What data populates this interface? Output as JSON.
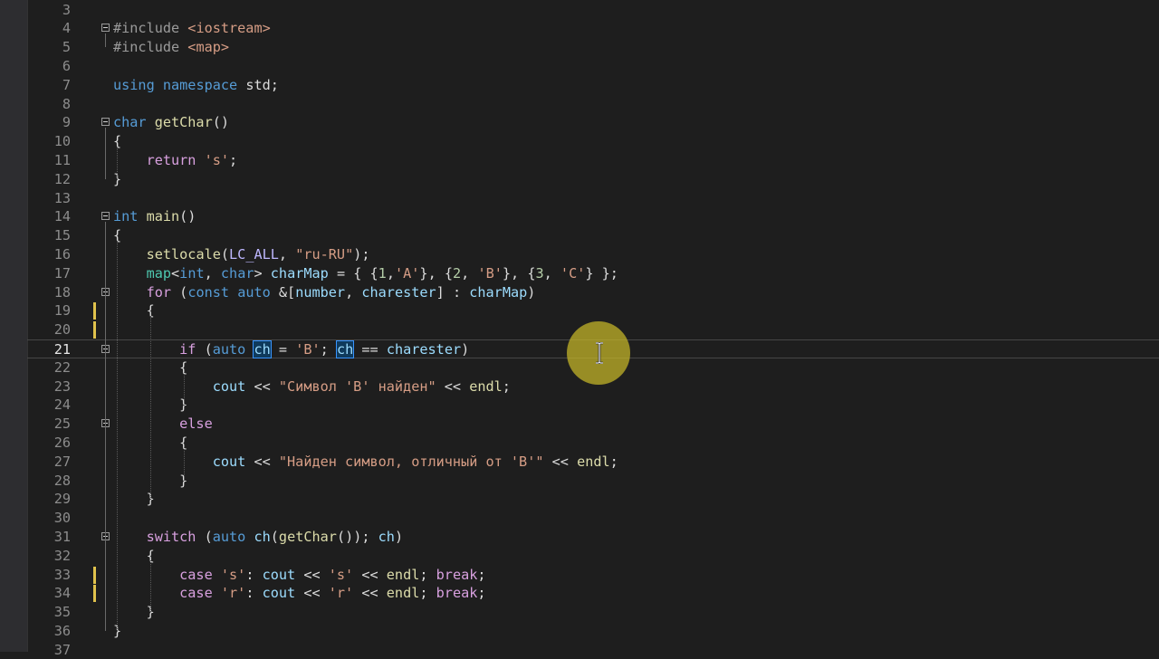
{
  "editor": {
    "current_line": "21",
    "lines": [
      {
        "n": "3",
        "tokens": []
      },
      {
        "n": "4",
        "tokens": [
          {
            "t": "#include ",
            "c": "pre"
          },
          {
            "t": "<iostream>",
            "c": "inc"
          }
        ]
      },
      {
        "n": "5",
        "tokens": [
          {
            "t": "#include ",
            "c": "pre"
          },
          {
            "t": "<map>",
            "c": "inc"
          }
        ]
      },
      {
        "n": "6",
        "tokens": []
      },
      {
        "n": "7",
        "tokens": [
          {
            "t": "using ",
            "c": "kw"
          },
          {
            "t": "namespace ",
            "c": "kw"
          },
          {
            "t": "std;",
            "c": "plain"
          }
        ]
      },
      {
        "n": "8",
        "tokens": []
      },
      {
        "n": "9",
        "tokens": [
          {
            "t": "char ",
            "c": "kw"
          },
          {
            "t": "getChar",
            "c": "fn"
          },
          {
            "t": "()",
            "c": "plain"
          }
        ]
      },
      {
        "n": "10",
        "tokens": [
          {
            "t": "{",
            "c": "plain"
          }
        ]
      },
      {
        "n": "11",
        "tokens": [
          {
            "t": "    return ",
            "c": "ctl"
          },
          {
            "t": "'s'",
            "c": "str"
          },
          {
            "t": ";",
            "c": "plain"
          }
        ]
      },
      {
        "n": "12",
        "tokens": [
          {
            "t": "}",
            "c": "plain"
          }
        ]
      },
      {
        "n": "13",
        "tokens": []
      },
      {
        "n": "14",
        "tokens": [
          {
            "t": "int ",
            "c": "kw"
          },
          {
            "t": "main",
            "c": "fn"
          },
          {
            "t": "()",
            "c": "plain"
          }
        ]
      },
      {
        "n": "15",
        "tokens": [
          {
            "t": "{",
            "c": "plain"
          }
        ]
      },
      {
        "n": "16",
        "tokens": [
          {
            "t": "    ",
            "c": "plain"
          },
          {
            "t": "setlocale",
            "c": "fn"
          },
          {
            "t": "(",
            "c": "plain"
          },
          {
            "t": "LC_ALL",
            "c": "mac"
          },
          {
            "t": ", ",
            "c": "plain"
          },
          {
            "t": "\"ru-RU\"",
            "c": "str"
          },
          {
            "t": ");",
            "c": "plain"
          }
        ]
      },
      {
        "n": "17",
        "tokens": [
          {
            "t": "    ",
            "c": "plain"
          },
          {
            "t": "map",
            "c": "ty"
          },
          {
            "t": "<",
            "c": "plain"
          },
          {
            "t": "int",
            "c": "kw"
          },
          {
            "t": ", ",
            "c": "plain"
          },
          {
            "t": "char",
            "c": "kw"
          },
          {
            "t": "> ",
            "c": "plain"
          },
          {
            "t": "charMap",
            "c": "var"
          },
          {
            "t": " = { {",
            "c": "plain"
          },
          {
            "t": "1",
            "c": "num"
          },
          {
            "t": ",",
            "c": "plain"
          },
          {
            "t": "'A'",
            "c": "str"
          },
          {
            "t": "}, {",
            "c": "plain"
          },
          {
            "t": "2",
            "c": "num"
          },
          {
            "t": ", ",
            "c": "plain"
          },
          {
            "t": "'B'",
            "c": "str"
          },
          {
            "t": "}, {",
            "c": "plain"
          },
          {
            "t": "3",
            "c": "num"
          },
          {
            "t": ", ",
            "c": "plain"
          },
          {
            "t": "'C'",
            "c": "str"
          },
          {
            "t": "} };",
            "c": "plain"
          }
        ]
      },
      {
        "n": "18",
        "tokens": [
          {
            "t": "    for ",
            "c": "ctl"
          },
          {
            "t": "(",
            "c": "plain"
          },
          {
            "t": "const ",
            "c": "kw"
          },
          {
            "t": "auto ",
            "c": "kw"
          },
          {
            "t": "&[",
            "c": "plain"
          },
          {
            "t": "number",
            "c": "var"
          },
          {
            "t": ", ",
            "c": "plain"
          },
          {
            "t": "charester",
            "c": "var"
          },
          {
            "t": "] : ",
            "c": "plain"
          },
          {
            "t": "charMap",
            "c": "var"
          },
          {
            "t": ")",
            "c": "plain"
          }
        ]
      },
      {
        "n": "19",
        "tokens": [
          {
            "t": "    {",
            "c": "plain"
          }
        ]
      },
      {
        "n": "20",
        "tokens": []
      },
      {
        "n": "21",
        "tokens": [
          {
            "t": "        if ",
            "c": "ctl"
          },
          {
            "t": "(",
            "c": "plain"
          },
          {
            "t": "auto ",
            "c": "kw"
          },
          {
            "t": "ch",
            "c": "hl"
          },
          {
            "t": " = ",
            "c": "plain"
          },
          {
            "t": "'B'",
            "c": "str"
          },
          {
            "t": "; ",
            "c": "plain"
          },
          {
            "t": "ch",
            "c": "hl"
          },
          {
            "t": " == ",
            "c": "plain"
          },
          {
            "t": "charester",
            "c": "var"
          },
          {
            "t": ")",
            "c": "plain"
          }
        ]
      },
      {
        "n": "22",
        "tokens": [
          {
            "t": "        {",
            "c": "plain"
          }
        ]
      },
      {
        "n": "23",
        "tokens": [
          {
            "t": "            ",
            "c": "plain"
          },
          {
            "t": "cout",
            "c": "var"
          },
          {
            "t": " << ",
            "c": "plain"
          },
          {
            "t": "\"Символ 'B' найден\"",
            "c": "str"
          },
          {
            "t": " << ",
            "c": "plain"
          },
          {
            "t": "endl",
            "c": "fn"
          },
          {
            "t": ";",
            "c": "plain"
          }
        ]
      },
      {
        "n": "24",
        "tokens": [
          {
            "t": "        }",
            "c": "plain"
          }
        ]
      },
      {
        "n": "25",
        "tokens": [
          {
            "t": "        else",
            "c": "ctl"
          }
        ]
      },
      {
        "n": "26",
        "tokens": [
          {
            "t": "        {",
            "c": "plain"
          }
        ]
      },
      {
        "n": "27",
        "tokens": [
          {
            "t": "            ",
            "c": "plain"
          },
          {
            "t": "cout",
            "c": "var"
          },
          {
            "t": " << ",
            "c": "plain"
          },
          {
            "t": "\"Найден символ, отличный от 'B'\"",
            "c": "str"
          },
          {
            "t": " << ",
            "c": "plain"
          },
          {
            "t": "endl",
            "c": "fn"
          },
          {
            "t": ";",
            "c": "plain"
          }
        ]
      },
      {
        "n": "28",
        "tokens": [
          {
            "t": "        }",
            "c": "plain"
          }
        ]
      },
      {
        "n": "29",
        "tokens": [
          {
            "t": "    }",
            "c": "plain"
          }
        ]
      },
      {
        "n": "30",
        "tokens": []
      },
      {
        "n": "31",
        "tokens": [
          {
            "t": "    switch ",
            "c": "ctl"
          },
          {
            "t": "(",
            "c": "plain"
          },
          {
            "t": "auto ",
            "c": "kw"
          },
          {
            "t": "ch",
            "c": "var"
          },
          {
            "t": "(",
            "c": "plain"
          },
          {
            "t": "getChar",
            "c": "fn"
          },
          {
            "t": "()); ",
            "c": "plain"
          },
          {
            "t": "ch",
            "c": "var"
          },
          {
            "t": ")",
            "c": "plain"
          }
        ]
      },
      {
        "n": "32",
        "tokens": [
          {
            "t": "    {",
            "c": "plain"
          }
        ]
      },
      {
        "n": "33",
        "tokens": [
          {
            "t": "        case ",
            "c": "ctl"
          },
          {
            "t": "'s'",
            "c": "str"
          },
          {
            "t": ": ",
            "c": "plain"
          },
          {
            "t": "cout",
            "c": "var"
          },
          {
            "t": " << ",
            "c": "plain"
          },
          {
            "t": "'s'",
            "c": "str"
          },
          {
            "t": " << ",
            "c": "plain"
          },
          {
            "t": "endl",
            "c": "fn"
          },
          {
            "t": "; ",
            "c": "plain"
          },
          {
            "t": "break",
            "c": "ctl"
          },
          {
            "t": ";",
            "c": "plain"
          }
        ]
      },
      {
        "n": "34",
        "tokens": [
          {
            "t": "        case ",
            "c": "ctl"
          },
          {
            "t": "'r'",
            "c": "str"
          },
          {
            "t": ": ",
            "c": "plain"
          },
          {
            "t": "cout",
            "c": "var"
          },
          {
            "t": " << ",
            "c": "plain"
          },
          {
            "t": "'r'",
            "c": "str"
          },
          {
            "t": " << ",
            "c": "plain"
          },
          {
            "t": "endl",
            "c": "fn"
          },
          {
            "t": "; ",
            "c": "plain"
          },
          {
            "t": "break",
            "c": "ctl"
          },
          {
            "t": ";",
            "c": "plain"
          }
        ]
      },
      {
        "n": "35",
        "tokens": [
          {
            "t": "    }",
            "c": "plain"
          }
        ]
      },
      {
        "n": "36",
        "tokens": [
          {
            "t": "}",
            "c": "plain"
          }
        ]
      },
      {
        "n": "37",
        "tokens": []
      }
    ],
    "fold_markers": [
      "4",
      "9",
      "14",
      "18",
      "21",
      "25",
      "31"
    ],
    "changed_lines": [
      "19",
      "20",
      "33",
      "34"
    ]
  },
  "colors": {
    "background": "#1e1e1e",
    "keyword": "#569cd6",
    "control": "#d8a0df",
    "function": "#dcdcaa",
    "type": "#4ec9b0",
    "string": "#d69d85",
    "variable": "#9cdcfe",
    "change_marker": "#e0c24c",
    "cursor_highlight": "#c8b928"
  },
  "icons": {
    "cursor": "i-beam-cursor-icon",
    "fold": "collapse-box-icon"
  }
}
